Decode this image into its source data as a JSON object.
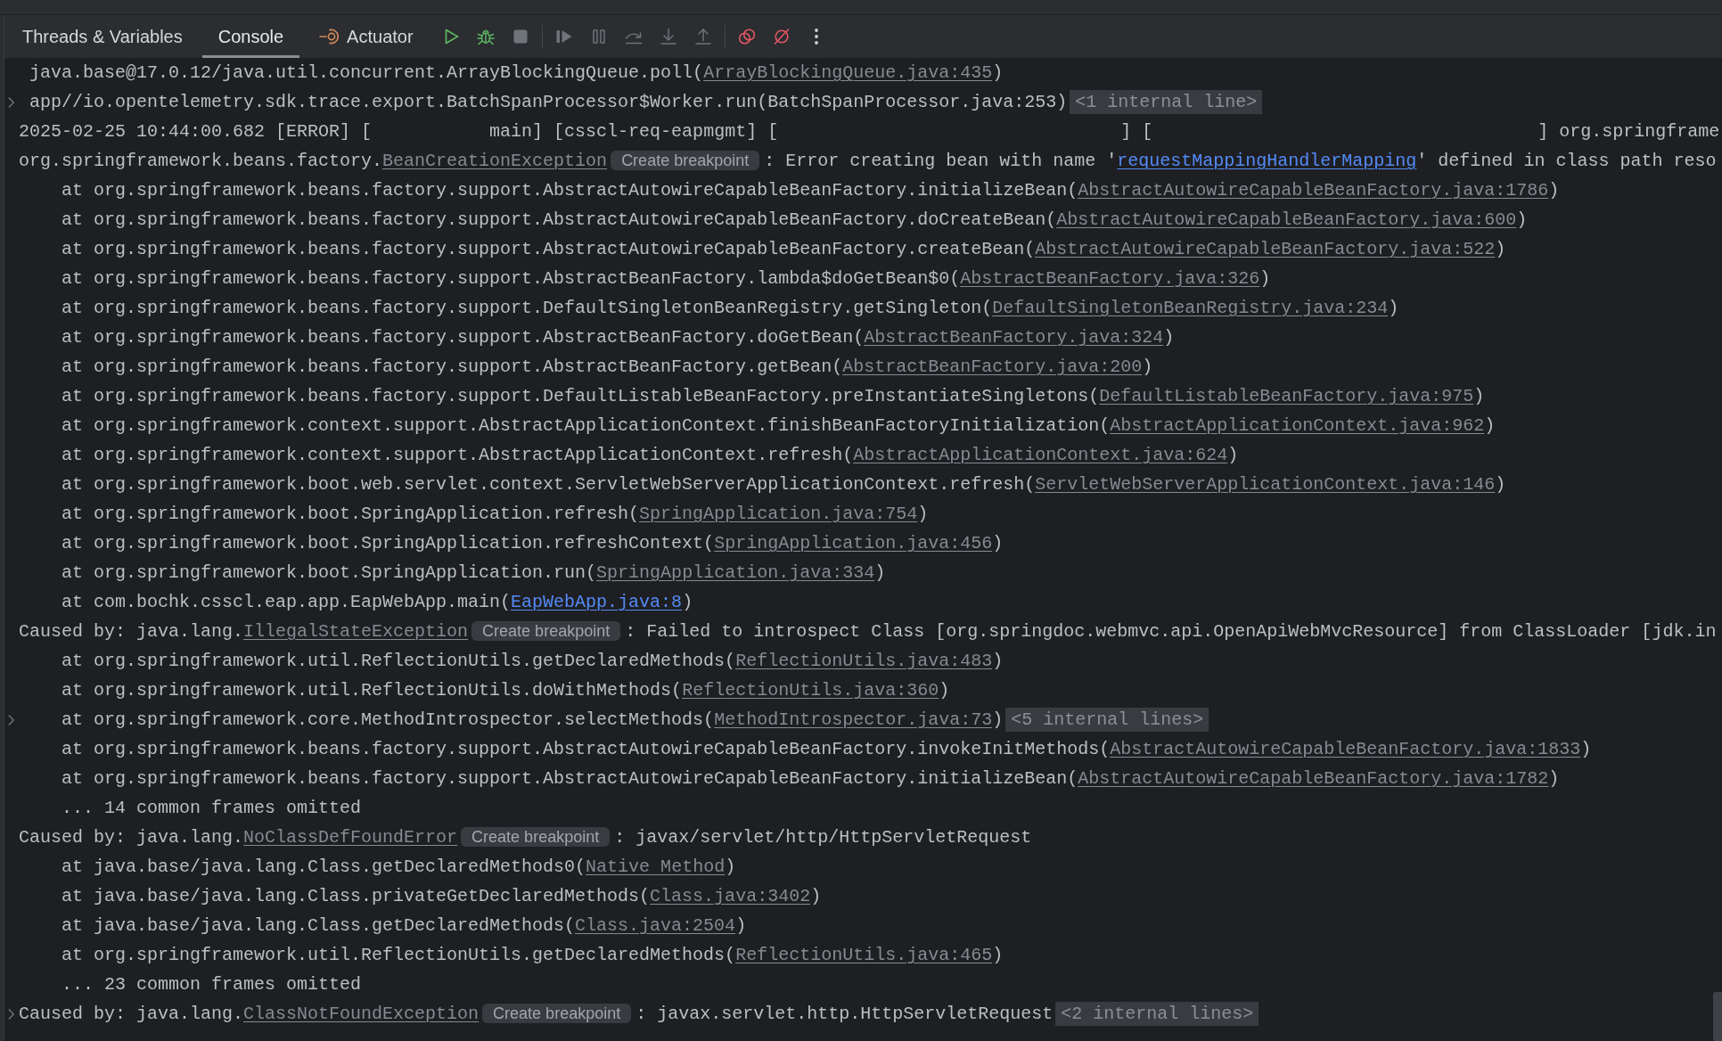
{
  "toolbar": {
    "tabs": [
      {
        "label": "Threads & Variables",
        "selected": false,
        "kind": "text"
      },
      {
        "label": "Console",
        "selected": true,
        "kind": "text"
      },
      {
        "label": "Actuator",
        "selected": false,
        "kind": "icon_text"
      }
    ],
    "actions": [
      {
        "disabled": false
      },
      {
        "disabled": false
      },
      {
        "disabled": true
      },
      {
        "disabled": true
      },
      {
        "disabled": true
      },
      {
        "disabled": true
      },
      {
        "disabled": true
      },
      {
        "disabled": true
      },
      {
        "disabled": false
      },
      {
        "disabled": false
      },
      {
        "disabled": false
      }
    ]
  },
  "console": {
    "lines": [
      {
        "kind": "thread_frame",
        "folded": false,
        "segments": [
          {
            "kind": "text",
            "text": "java.base@17.0.12/java.util.concurrent.ArrayBlockingQueue.poll("
          },
          {
            "kind": "link",
            "text": "ArrayBlockingQueue.java:435"
          },
          {
            "kind": "text",
            "text": ")"
          }
        ]
      },
      {
        "kind": "thread_frame",
        "folded": true,
        "segments": [
          {
            "kind": "text",
            "text": "app//io.opentelemetry.sdk.trace.export.BatchSpanProcessor$Worker.run(BatchSpanProcessor.java:253)"
          },
          {
            "kind": "fold_hint",
            "text": "<1 internal line>"
          }
        ]
      },
      {
        "kind": "message",
        "folded": false,
        "segments": [
          {
            "kind": "text",
            "text": "2025-02-25 10:44:00.682 [ERROR] [           main] [csscl-req-eapmgmt] [                                ] [                                    ] org.springframe"
          }
        ]
      },
      {
        "kind": "message",
        "folded": false,
        "segments": [
          {
            "kind": "text",
            "text": "org.springframework.beans.factory."
          },
          {
            "kind": "link",
            "text": "BeanCreationException"
          },
          {
            "kind": "breakpoint_hint",
            "text": "Create breakpoint"
          },
          {
            "kind": "text",
            "text": ": Error creating bean with name '"
          },
          {
            "kind": "url_link",
            "text": "requestMappingHandlerMapping"
          },
          {
            "kind": "text",
            "text": "' defined in class path reso"
          }
        ]
      },
      {
        "kind": "frame",
        "folded": false,
        "segments": [
          {
            "kind": "text",
            "text": "at org.springframework.beans.factory.support.AbstractAutowireCapableBeanFactory.initializeBean("
          },
          {
            "kind": "link",
            "text": "AbstractAutowireCapableBeanFactory.java:1786"
          },
          {
            "kind": "text",
            "text": ")"
          }
        ]
      },
      {
        "kind": "frame",
        "folded": false,
        "segments": [
          {
            "kind": "text",
            "text": "at org.springframework.beans.factory.support.AbstractAutowireCapableBeanFactory.doCreateBean("
          },
          {
            "kind": "link",
            "text": "AbstractAutowireCapableBeanFactory.java:600"
          },
          {
            "kind": "text",
            "text": ")"
          }
        ]
      },
      {
        "kind": "frame",
        "folded": false,
        "segments": [
          {
            "kind": "text",
            "text": "at org.springframework.beans.factory.support.AbstractAutowireCapableBeanFactory.createBean("
          },
          {
            "kind": "link",
            "text": "AbstractAutowireCapableBeanFactory.java:522"
          },
          {
            "kind": "text",
            "text": ")"
          }
        ]
      },
      {
        "kind": "frame",
        "folded": false,
        "segments": [
          {
            "kind": "text",
            "text": "at org.springframework.beans.factory.support.AbstractBeanFactory.lambda$doGetBean$0("
          },
          {
            "kind": "link",
            "text": "AbstractBeanFactory.java:326"
          },
          {
            "kind": "text",
            "text": ")"
          }
        ]
      },
      {
        "kind": "frame",
        "folded": false,
        "segments": [
          {
            "kind": "text",
            "text": "at org.springframework.beans.factory.support.DefaultSingletonBeanRegistry.getSingleton("
          },
          {
            "kind": "link",
            "text": "DefaultSingletonBeanRegistry.java:234"
          },
          {
            "kind": "text",
            "text": ")"
          }
        ]
      },
      {
        "kind": "frame",
        "folded": false,
        "segments": [
          {
            "kind": "text",
            "text": "at org.springframework.beans.factory.support.AbstractBeanFactory.doGetBean("
          },
          {
            "kind": "link",
            "text": "AbstractBeanFactory.java:324"
          },
          {
            "kind": "text",
            "text": ")"
          }
        ]
      },
      {
        "kind": "frame",
        "folded": false,
        "segments": [
          {
            "kind": "text",
            "text": "at org.springframework.beans.factory.support.AbstractBeanFactory.getBean("
          },
          {
            "kind": "link",
            "text": "AbstractBeanFactory.java:200"
          },
          {
            "kind": "text",
            "text": ")"
          }
        ]
      },
      {
        "kind": "frame",
        "folded": false,
        "segments": [
          {
            "kind": "text",
            "text": "at org.springframework.beans.factory.support.DefaultListableBeanFactory.preInstantiateSingletons("
          },
          {
            "kind": "link",
            "text": "DefaultListableBeanFactory.java:975"
          },
          {
            "kind": "text",
            "text": ")"
          }
        ]
      },
      {
        "kind": "frame",
        "folded": false,
        "segments": [
          {
            "kind": "text",
            "text": "at org.springframework.context.support.AbstractApplicationContext.finishBeanFactoryInitialization("
          },
          {
            "kind": "link",
            "text": "AbstractApplicationContext.java:962"
          },
          {
            "kind": "text",
            "text": ")"
          }
        ]
      },
      {
        "kind": "frame",
        "folded": false,
        "segments": [
          {
            "kind": "text",
            "text": "at org.springframework.context.support.AbstractApplicationContext.refresh("
          },
          {
            "kind": "link",
            "text": "AbstractApplicationContext.java:624"
          },
          {
            "kind": "text",
            "text": ")"
          }
        ]
      },
      {
        "kind": "frame",
        "folded": false,
        "segments": [
          {
            "kind": "text",
            "text": "at org.springframework.boot.web.servlet.context.ServletWebServerApplicationContext.refresh("
          },
          {
            "kind": "link",
            "text": "ServletWebServerApplicationContext.java:146"
          },
          {
            "kind": "text",
            "text": ")"
          }
        ]
      },
      {
        "kind": "frame",
        "folded": false,
        "segments": [
          {
            "kind": "text",
            "text": "at org.springframework.boot.SpringApplication.refresh("
          },
          {
            "kind": "link",
            "text": "SpringApplication.java:754"
          },
          {
            "kind": "text",
            "text": ")"
          }
        ]
      },
      {
        "kind": "frame",
        "folded": false,
        "segments": [
          {
            "kind": "text",
            "text": "at org.springframework.boot.SpringApplication.refreshContext("
          },
          {
            "kind": "link",
            "text": "SpringApplication.java:456"
          },
          {
            "kind": "text",
            "text": ")"
          }
        ]
      },
      {
        "kind": "frame",
        "folded": false,
        "segments": [
          {
            "kind": "text",
            "text": "at org.springframework.boot.SpringApplication.run("
          },
          {
            "kind": "link",
            "text": "SpringApplication.java:334"
          },
          {
            "kind": "text",
            "text": ")"
          }
        ]
      },
      {
        "kind": "frame",
        "folded": false,
        "segments": [
          {
            "kind": "text",
            "text": "at com.bochk.csscl.eap.app.EapWebApp.main("
          },
          {
            "kind": "url_link",
            "text": "EapWebApp.java:8"
          },
          {
            "kind": "text",
            "text": ")"
          }
        ]
      },
      {
        "kind": "message",
        "folded": false,
        "segments": [
          {
            "kind": "text",
            "text": "Caused by: java.lang."
          },
          {
            "kind": "link",
            "text": "IllegalStateException"
          },
          {
            "kind": "breakpoint_hint",
            "text": "Create breakpoint"
          },
          {
            "kind": "text",
            "text": ": Failed to introspect Class [org.springdoc.webmvc.api.OpenApiWebMvcResource] from ClassLoader [jdk.in"
          }
        ]
      },
      {
        "kind": "frame",
        "folded": false,
        "segments": [
          {
            "kind": "text",
            "text": "at org.springframework.util.ReflectionUtils.getDeclaredMethods("
          },
          {
            "kind": "link",
            "text": "ReflectionUtils.java:483"
          },
          {
            "kind": "text",
            "text": ")"
          }
        ]
      },
      {
        "kind": "frame",
        "folded": false,
        "segments": [
          {
            "kind": "text",
            "text": "at org.springframework.util.ReflectionUtils.doWithMethods("
          },
          {
            "kind": "link",
            "text": "ReflectionUtils.java:360"
          },
          {
            "kind": "text",
            "text": ")"
          }
        ]
      },
      {
        "kind": "frame",
        "folded": true,
        "segments": [
          {
            "kind": "text",
            "text": "at org.springframework.core.MethodIntrospector.selectMethods("
          },
          {
            "kind": "link",
            "text": "MethodIntrospector.java:73"
          },
          {
            "kind": "text",
            "text": ")"
          },
          {
            "kind": "fold_hint",
            "text": "<5 internal lines>"
          }
        ]
      },
      {
        "kind": "frame",
        "folded": false,
        "segments": [
          {
            "kind": "text",
            "text": "at org.springframework.beans.factory.support.AbstractAutowireCapableBeanFactory.invokeInitMethods("
          },
          {
            "kind": "link",
            "text": "AbstractAutowireCapableBeanFactory.java:1833"
          },
          {
            "kind": "text",
            "text": ")"
          }
        ]
      },
      {
        "kind": "frame",
        "folded": false,
        "segments": [
          {
            "kind": "text",
            "text": "at org.springframework.beans.factory.support.AbstractAutowireCapableBeanFactory.initializeBean("
          },
          {
            "kind": "link",
            "text": "AbstractAutowireCapableBeanFactory.java:1782"
          },
          {
            "kind": "text",
            "text": ")"
          }
        ]
      },
      {
        "kind": "frame",
        "folded": false,
        "segments": [
          {
            "kind": "text",
            "text": "... 14 common frames omitted"
          }
        ]
      },
      {
        "kind": "message",
        "folded": false,
        "segments": [
          {
            "kind": "text",
            "text": "Caused by: java.lang."
          },
          {
            "kind": "link",
            "text": "NoClassDefFoundError"
          },
          {
            "kind": "breakpoint_hint",
            "text": "Create breakpoint"
          },
          {
            "kind": "text",
            "text": ": javax/servlet/http/HttpServletRequest"
          }
        ]
      },
      {
        "kind": "frame",
        "folded": false,
        "segments": [
          {
            "kind": "text",
            "text": "at java.base/java.lang.Class.getDeclaredMethods0("
          },
          {
            "kind": "link",
            "text": "Native Method"
          },
          {
            "kind": "text",
            "text": ")"
          }
        ]
      },
      {
        "kind": "frame",
        "folded": false,
        "segments": [
          {
            "kind": "text",
            "text": "at java.base/java.lang.Class.privateGetDeclaredMethods("
          },
          {
            "kind": "link",
            "text": "Class.java:3402"
          },
          {
            "kind": "text",
            "text": ")"
          }
        ]
      },
      {
        "kind": "frame",
        "folded": false,
        "segments": [
          {
            "kind": "text",
            "text": "at java.base/java.lang.Class.getDeclaredMethods("
          },
          {
            "kind": "link",
            "text": "Class.java:2504"
          },
          {
            "kind": "text",
            "text": ")"
          }
        ]
      },
      {
        "kind": "frame",
        "folded": false,
        "segments": [
          {
            "kind": "text",
            "text": "at org.springframework.util.ReflectionUtils.getDeclaredMethods("
          },
          {
            "kind": "link",
            "text": "ReflectionUtils.java:465"
          },
          {
            "kind": "text",
            "text": ")"
          }
        ]
      },
      {
        "kind": "frame",
        "folded": false,
        "segments": [
          {
            "kind": "text",
            "text": "... 23 common frames omitted"
          }
        ]
      },
      {
        "kind": "message",
        "folded": true,
        "segments": [
          {
            "kind": "text",
            "text": "Caused by: java.lang."
          },
          {
            "kind": "link",
            "text": "ClassNotFoundException"
          },
          {
            "kind": "breakpoint_hint",
            "text": "Create breakpoint"
          },
          {
            "kind": "text",
            "text": ": javax.servlet.http.HttpServletRequest"
          },
          {
            "kind": "fold_hint",
            "text": "<2 internal lines>"
          }
        ]
      }
    ]
  }
}
